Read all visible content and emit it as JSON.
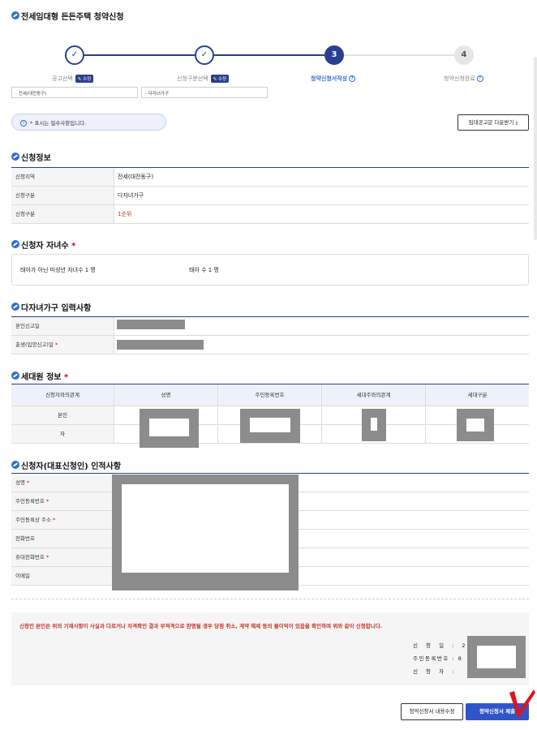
{
  "page_title": "전세임대형 든든주택 청약신청",
  "stepper": {
    "steps": [
      {
        "number": "✓",
        "label": "공고선택",
        "badge": "수정",
        "state": "done"
      },
      {
        "number": "✓",
        "label": "신청구분선택",
        "badge": "수정",
        "state": "done"
      },
      {
        "number": "3",
        "label": "청약신청서작성",
        "state": "active"
      },
      {
        "number": "4",
        "label": "청약신청완료",
        "state": "pending"
      }
    ],
    "selections": [
      "- 전세(대전동구)",
      "- 다자녀가구"
    ]
  },
  "notice": "* 표시는 필수사항입니다.",
  "download_button": "임대공고문 다운받기",
  "application_info": {
    "title": "신청정보",
    "rows": [
      {
        "key": "신청지역",
        "value": "전세(대전동구)"
      },
      {
        "key": "신청구분",
        "value": "다자녀가구"
      },
      {
        "key": "신청구분",
        "value": "1순위"
      }
    ]
  },
  "children": {
    "title": "신청자 자녀수",
    "required": "*",
    "minor_children": "태아가 아닌 미성년 자녀수 1 명",
    "unborn": "태아 수 1 명"
  },
  "multi_child": {
    "title": "다자녀가구 입력사항",
    "rows": [
      {
        "key": "혼인신고일",
        "required": ""
      },
      {
        "key": "출생(입양신고)일",
        "required": "*"
      }
    ]
  },
  "household": {
    "title": "세대원 정보",
    "required": "*",
    "headers": [
      "신청자와의관계",
      "성명",
      "주민등록번호",
      "세대주와의관계",
      "세대구분"
    ],
    "rows": [
      {
        "relation": "본인"
      },
      {
        "relation": "자"
      }
    ]
  },
  "applicant": {
    "title": "신청자(대표신청인) 인적사항",
    "rows": [
      {
        "key": "성명",
        "required": "*"
      },
      {
        "key": "주민등록번호",
        "required": "*"
      },
      {
        "key": "주민등록상 주소",
        "required": "*"
      },
      {
        "key": "전화번호",
        "required": ""
      },
      {
        "key": "휴대전화번호",
        "required": "*"
      },
      {
        "key": "이메일",
        "required": ""
      }
    ]
  },
  "pledge": {
    "text": "신청인 본인은 위의 기재사항이 사실과 다르거나 자격확인 결과 부적격으로 판명될 경우 당첨 취소, 계약 해제 등의 불이익이 있음을 확인하며 위와 같이 신청합니다.",
    "signature_labels": [
      "신 청 일 : 2",
      "주민등록번호 : 8",
      "신 청 자 : "
    ]
  },
  "buttons": {
    "edit": "청약신청서 내용수정",
    "submit": "청약신청서 제출"
  },
  "colors": {
    "primary": "#2a3f8f",
    "accent": "#2f55c9",
    "required": "#d0021b",
    "redaction": "#8c8c8c"
  }
}
